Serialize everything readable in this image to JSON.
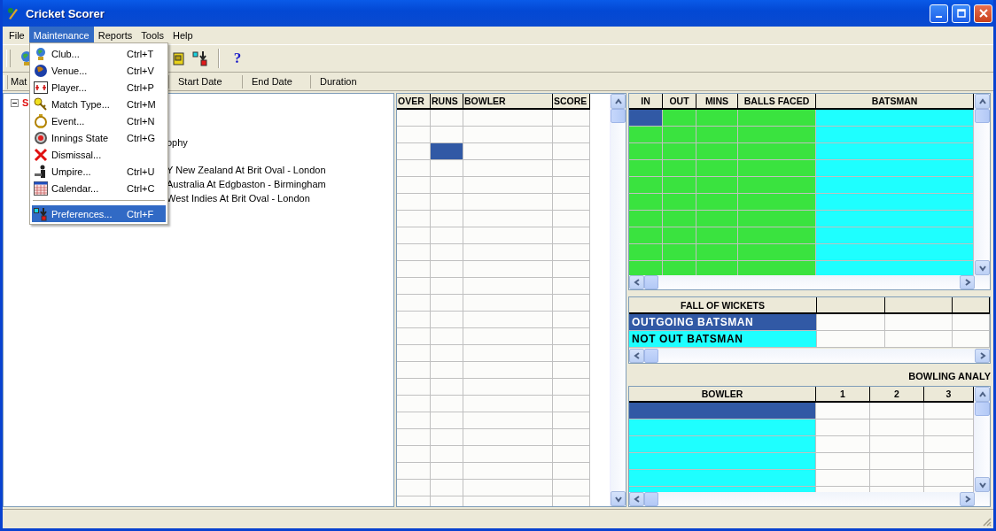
{
  "window": {
    "title": "Cricket Scorer"
  },
  "menu_bar": [
    {
      "label": "File",
      "selected": false
    },
    {
      "label": "Maintenance",
      "selected": true
    },
    {
      "label": "Reports",
      "selected": false
    },
    {
      "label": "Tools",
      "selected": false
    },
    {
      "label": "Help",
      "selected": false
    }
  ],
  "open_menu": [
    {
      "kind": "item",
      "label": "Club...",
      "shortcut": "Ctrl+T",
      "selected": false
    },
    {
      "kind": "item",
      "label": "Venue...",
      "shortcut": "Ctrl+V",
      "selected": false
    },
    {
      "kind": "item",
      "label": "Player...",
      "shortcut": "Ctrl+P",
      "selected": false
    },
    {
      "kind": "item",
      "label": "Match Type...",
      "shortcut": "Ctrl+M",
      "selected": false
    },
    {
      "kind": "item",
      "label": "Event...",
      "shortcut": "Ctrl+N",
      "selected": false
    },
    {
      "kind": "item",
      "label": "Innings State",
      "shortcut": "Ctrl+G",
      "selected": false
    },
    {
      "kind": "item",
      "label": "Dismissal...",
      "selected": false
    },
    {
      "kind": "item",
      "label": "Umpire...",
      "shortcut": "Ctrl+U",
      "selected": false
    },
    {
      "kind": "item",
      "label": "Calendar...",
      "shortcut": "Ctrl+C",
      "selected": false
    },
    {
      "kind": "separator"
    },
    {
      "kind": "item",
      "label": "Preferences...",
      "shortcut": "Ctrl+F",
      "selected": true
    }
  ],
  "toolbar": {
    "help_label": "?"
  },
  "list_header": [
    "Mat",
    "Start Date",
    "End Date",
    "Duration"
  ],
  "tree": {
    "label": "S",
    "expanded": true,
    "children": [
      {
        "label": "ophy"
      },
      {
        "label": "Y New Zealand At Brit Oval - London"
      },
      {
        "label": "Australia At Edgbaston - Birmingham"
      },
      {
        "label": "West Indies At Brit Oval - London"
      }
    ]
  },
  "over_grid": {
    "columns": [
      {
        "label": "OVER"
      },
      {
        "label": "RUNS"
      },
      {
        "label": "BOWLER"
      },
      {
        "label": "SCORE"
      }
    ],
    "rows": [
      {
        "selected": [
          false,
          false,
          false,
          false
        ]
      },
      {
        "selected": [
          false,
          false,
          false,
          false
        ]
      },
      {
        "selected": [
          false,
          true,
          false,
          false
        ]
      },
      {
        "selected": [
          false,
          false,
          false,
          false
        ]
      },
      {
        "selected": [
          false,
          false,
          false,
          false
        ]
      },
      {
        "selected": [
          false,
          false,
          false,
          false
        ]
      },
      {
        "selected": [
          false,
          false,
          false,
          false
        ]
      },
      {
        "selected": [
          false,
          false,
          false,
          false
        ]
      },
      {
        "selected": [
          false,
          false,
          false,
          false
        ]
      },
      {
        "selected": [
          false,
          false,
          false,
          false
        ]
      },
      {
        "selected": [
          false,
          false,
          false,
          false
        ]
      },
      {
        "selected": [
          false,
          false,
          false,
          false
        ]
      },
      {
        "selected": [
          false,
          false,
          false,
          false
        ]
      },
      {
        "selected": [
          false,
          false,
          false,
          false
        ]
      },
      {
        "selected": [
          false,
          false,
          false,
          false
        ]
      },
      {
        "selected": [
          false,
          false,
          false,
          false
        ]
      },
      {
        "selected": [
          false,
          false,
          false,
          false
        ]
      },
      {
        "selected": [
          false,
          false,
          false,
          false
        ]
      },
      {
        "selected": [
          false,
          false,
          false,
          false
        ]
      },
      {
        "selected": [
          false,
          false,
          false,
          false
        ]
      },
      {
        "selected": [
          false,
          false,
          false,
          false
        ]
      },
      {
        "selected": [
          false,
          false,
          false,
          false
        ]
      },
      {
        "selected": [
          false,
          false,
          false,
          false
        ]
      },
      {
        "selected": [
          false,
          false,
          false,
          false
        ]
      }
    ]
  },
  "batsman_grid": {
    "columns": [
      {
        "label": "IN",
        "color": "#3ae33f"
      },
      {
        "label": "OUT",
        "color": "#3ae33f"
      },
      {
        "label": "MINS",
        "color": "#3ae33f"
      },
      {
        "label": "BALLS FACED",
        "color": "#3ae33f"
      },
      {
        "label": "BATSMAN",
        "color": "#1effff"
      }
    ],
    "rows": [
      {
        "selected": [
          true,
          false,
          false,
          false,
          false
        ]
      },
      {
        "selected": [
          false,
          false,
          false,
          false,
          false
        ]
      },
      {
        "selected": [
          false,
          false,
          false,
          false,
          false
        ]
      },
      {
        "selected": [
          false,
          false,
          false,
          false,
          false
        ]
      },
      {
        "selected": [
          false,
          false,
          false,
          false,
          false
        ]
      },
      {
        "selected": [
          false,
          false,
          false,
          false,
          false
        ]
      },
      {
        "selected": [
          false,
          false,
          false,
          false,
          false
        ]
      },
      {
        "selected": [
          false,
          false,
          false,
          false,
          false
        ]
      },
      {
        "selected": [
          false,
          false,
          false,
          false,
          false
        ]
      },
      {
        "selected": [
          false,
          false,
          false,
          false,
          false
        ]
      }
    ]
  },
  "fall_of_wickets": {
    "heading": "FALL OF WICKETS",
    "rows": [
      {
        "label": "OUTGOING BATSMAN",
        "selected": true
      },
      {
        "label": "NOT OUT BATSMAN",
        "selected": false
      }
    ]
  },
  "bowling_analysis": {
    "title": "BOWLING ANALY",
    "columns": [
      {
        "label": "BOWLER",
        "color": "#1effff"
      },
      {
        "label": "1",
        "color": "#fcfcfa"
      },
      {
        "label": "2",
        "color": "#fcfcfa"
      },
      {
        "label": "3",
        "color": "#fcfcfa"
      }
    ],
    "rows": [
      {
        "selected": [
          true,
          false,
          false,
          false
        ]
      },
      {
        "selected": [
          false,
          false,
          false,
          false
        ]
      },
      {
        "selected": [
          false,
          false,
          false,
          false
        ]
      },
      {
        "selected": [
          false,
          false,
          false,
          false
        ]
      },
      {
        "selected": [
          false,
          false,
          false,
          false
        ]
      },
      {
        "selected": [
          false,
          false,
          false,
          false
        ]
      }
    ]
  }
}
